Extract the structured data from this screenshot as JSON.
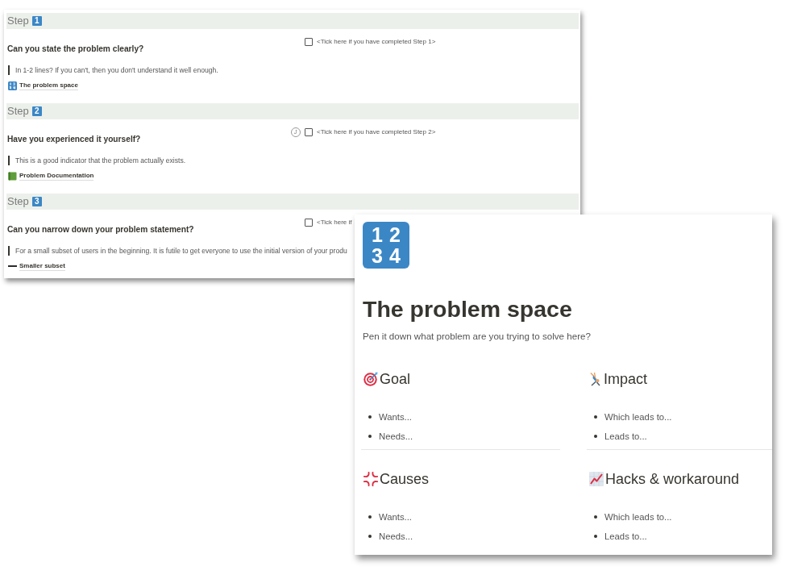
{
  "steps": [
    {
      "label": "Step",
      "number": "1",
      "question": "Can you state the problem clearly?",
      "checkbox": {
        "label": "<Tick here if you have completed Step 1>",
        "checked": false
      },
      "quote": "In 1-2 lines? If you can't, then you don't understand it well enough.",
      "link": "The problem space"
    },
    {
      "label": "Step",
      "number": "2",
      "question": "Have you experienced it yourself?",
      "avatar": "J",
      "checkbox": {
        "label": "<Tick here if you have completed Step 2>",
        "checked": false
      },
      "quote": "This is a good indicator that the problem actually exists.",
      "link": "Problem Documentation"
    },
    {
      "label": "Step",
      "number": "3",
      "question": "Can you narrow down your problem statement?",
      "checkbox": {
        "label": "<Tick here if",
        "checked": false
      },
      "quote": "For a small subset of users in the beginning. It is futile to get everyone to use the initial version of your produ",
      "link": "Smaller subset"
    }
  ],
  "page": {
    "icon_digits": [
      "1",
      "2",
      "3",
      "4"
    ],
    "title": "The problem space",
    "subtitle": "Pen it down what problem are you trying to solve here?",
    "sections": [
      {
        "heading": "Goal",
        "items": [
          "Wants...",
          "Needs..."
        ]
      },
      {
        "heading": "Impact",
        "items": [
          "Which leads to...",
          "Leads to..."
        ]
      },
      {
        "heading": "Causes",
        "items": [
          "Wants...",
          "Needs..."
        ]
      },
      {
        "heading": "Hacks & workaround",
        "items": [
          "Which leads to...",
          "Leads to..."
        ]
      }
    ]
  }
}
